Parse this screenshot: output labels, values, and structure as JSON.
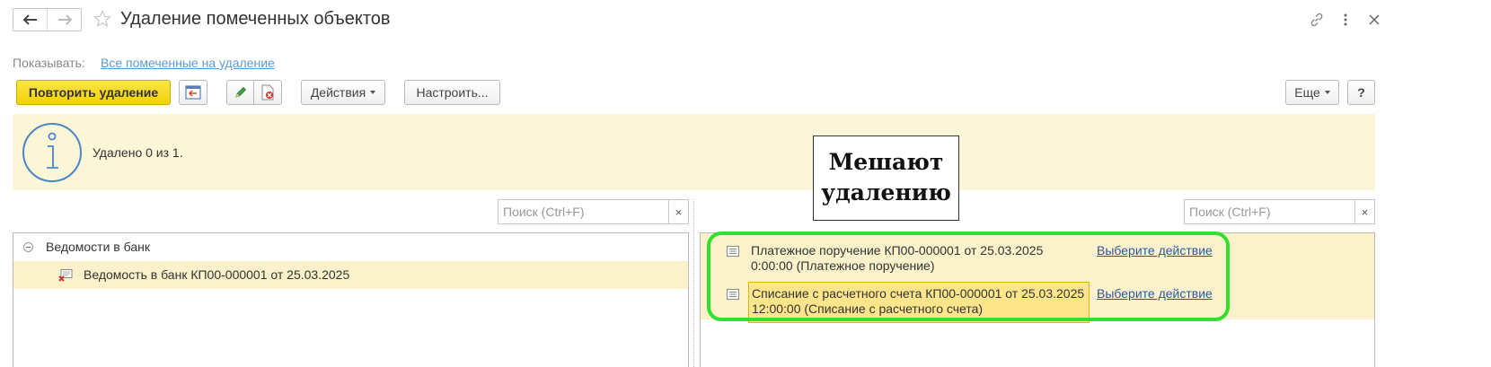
{
  "window": {
    "title": "Удаление помеченных объектов"
  },
  "filter": {
    "label": "Показывать:",
    "value": "Все помеченные на удаление"
  },
  "toolbar": {
    "repeat_delete_label": "Повторить удаление",
    "actions_label": "Действия",
    "configure_label": "Настроить...",
    "more_label": "Еще",
    "help_label": "?"
  },
  "info": {
    "message": "Удалено 0 из 1."
  },
  "callout": {
    "line1": "Мешают",
    "line2": "удалению"
  },
  "search": {
    "placeholder": "Поиск (Ctrl+F)",
    "clear_glyph": "×"
  },
  "deleted_tree": {
    "group_label": "Ведомости в банк",
    "items": [
      {
        "label": "Ведомость в банк КП00-000001 от 25.03.2025"
      }
    ]
  },
  "blockers": {
    "rows": [
      {
        "text": "Платежное поручение КП00-000001 от 25.03.2025 0:00:00 (Платежное поручение)",
        "action": "Выберите действие",
        "selected": false
      },
      {
        "text": "Списание с расчетного счета КП00-000001 от 25.03.2025 12:00:00 (Списание с расчетного счета)",
        "action": "Выберите действие",
        "selected": true
      }
    ]
  },
  "colors": {
    "primary_button": "#f2d200",
    "info_background": "#fbf6d8",
    "row_highlight": "#fbf1cb",
    "selected_cell": "#fde58c",
    "link": "#2d57a6",
    "annotation_ring": "#2fe02f"
  }
}
